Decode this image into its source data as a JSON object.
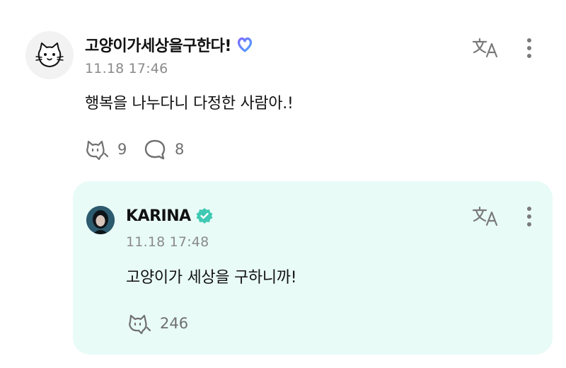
{
  "comment": {
    "author": "고양이가세상을구한다!",
    "timestamp": "11.18 17:46",
    "text": "행복을 나누다니 다정한 사람아.!",
    "likes": "9",
    "replies": "8",
    "avatar_icon": "cat-face-icon",
    "badge_icon": "heart-badge-icon",
    "translate_icon": "translate-icon",
    "more_icon": "more-vertical-icon"
  },
  "reply": {
    "author": "KARINA",
    "timestamp": "11.18 17:48",
    "text": "고양이가 세상을 구하니까!",
    "likes": "246",
    "verified_icon": "verified-badge-icon",
    "translate_icon": "translate-icon",
    "more_icon": "more-vertical-icon",
    "card_color": "#e8fbf7",
    "accent_color": "#3fc9b4"
  }
}
